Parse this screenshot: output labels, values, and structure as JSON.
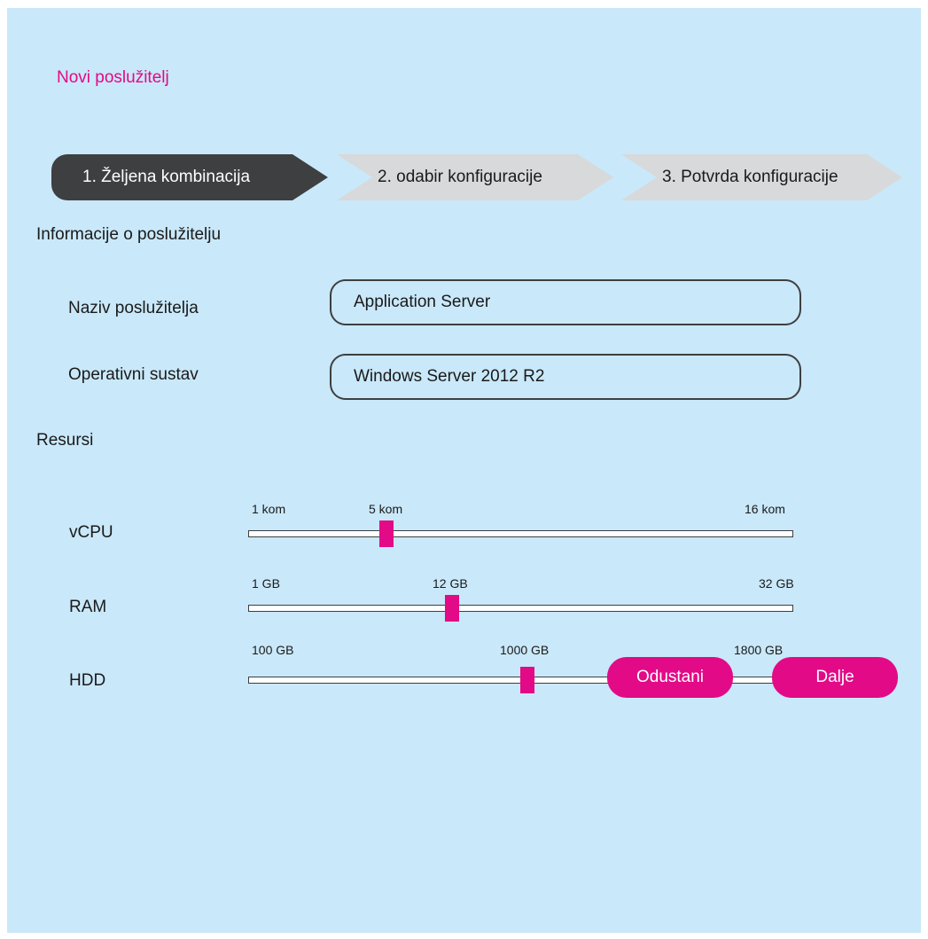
{
  "page": {
    "title": "Novi poslužitelj",
    "accent_color": "#e20a87",
    "background_color": "#c9e8f9"
  },
  "steps": [
    {
      "label": "1. Željena kombinacija",
      "active": true
    },
    {
      "label": "2. odabir konfiguracije",
      "active": false
    },
    {
      "label": "3. Potvrda konfiguracije",
      "active": false
    }
  ],
  "info": {
    "heading": "Informacije o poslužitelju",
    "server_name_label": "Naziv poslužitelja",
    "server_name_value": "Application Server",
    "os_label": "Operativni sustav",
    "os_value": "Windows Server 2012 R2"
  },
  "resources": {
    "heading": "Resursi",
    "sliders": [
      {
        "label": "vCPU",
        "min": 1,
        "max": 16,
        "value": 5,
        "min_label": "1 kom",
        "value_label": "5 kom",
        "max_label": "16 kom"
      },
      {
        "label": "RAM",
        "min": 1,
        "max": 32,
        "value": 12,
        "min_label": "1 GB",
        "value_label": "12 GB",
        "max_label": "32 GB"
      },
      {
        "label": "HDD",
        "min": 100,
        "max": 1800,
        "value": 1000,
        "min_label": "100 GB",
        "value_label": "1000 GB",
        "max_label": "1800 GB"
      }
    ]
  },
  "actions": {
    "cancel_label": "Odustani",
    "next_label": "Dalje"
  }
}
